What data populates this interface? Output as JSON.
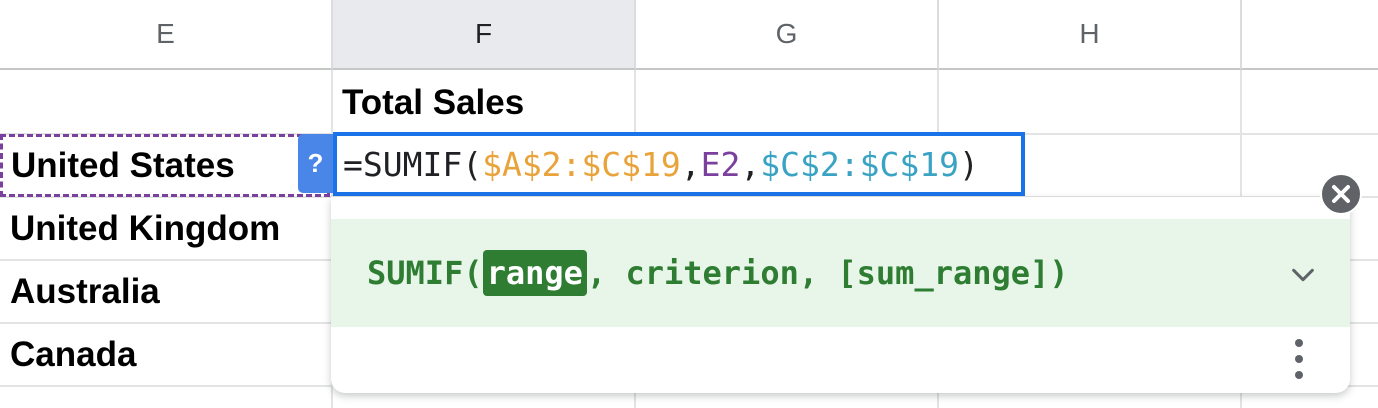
{
  "columns": [
    "E",
    "F",
    "G",
    "H"
  ],
  "header_cell": "Total Sales",
  "countries": [
    "United States",
    "United Kingdom",
    "Australia",
    "Canada"
  ],
  "formula": {
    "prefix": "=SUMIF(",
    "arg1": "$A$2:$C$19",
    "sep1": ",",
    "arg2": "E2",
    "sep2": ",",
    "arg3": "$C$2:$C$19",
    "suffix": ")"
  },
  "help_badge": "?",
  "tooltip": {
    "fn": "SUMIF(",
    "active_param": "range",
    "rest": ", criterion, [sum_range])"
  },
  "colors": {
    "arg1": "#e8a33a",
    "arg2": "#7b3f9e",
    "arg3": "#3aa3c4",
    "selection": "#1a73e8",
    "tooltip_text": "#2e7d32",
    "tooltip_bg": "#e8f5e9"
  },
  "icons": [
    "close-icon",
    "chevron-down-icon",
    "more-vert-icon",
    "help-icon"
  ]
}
